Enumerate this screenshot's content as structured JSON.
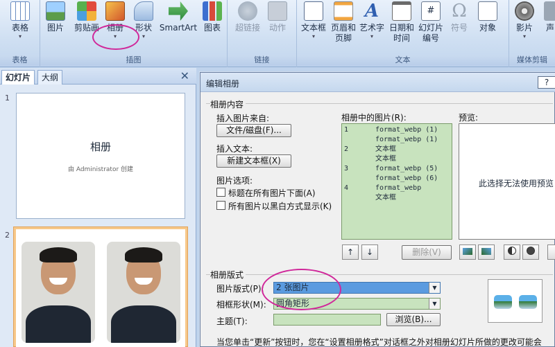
{
  "ribbon": {
    "groups": {
      "table": "表格",
      "illustrations": "插图",
      "links": "链接",
      "text": "文本",
      "media": "媒体剪辑"
    },
    "buttons": {
      "table": "表格",
      "picture": "图片",
      "clipart": "剪贴画",
      "album": "相册",
      "shapes": "形状",
      "smartart": "SmartArt",
      "chart": "图表",
      "hyperlink": "超链接",
      "action": "动作",
      "textbox": "文本框",
      "header_1": "页眉和",
      "header_2": "页脚",
      "wordart": "艺术字",
      "datetime_1": "日期和",
      "datetime_2": "时间",
      "slidenum_1": "幻灯片",
      "slidenum_2": "编号",
      "symbol": "符号",
      "object": "对象",
      "movie": "影片",
      "sound": "声"
    },
    "arrow": "▾",
    "colors": {
      "album_circle": "#d0289a"
    }
  },
  "panel": {
    "tab_slides": "幻灯片",
    "tab_outline": "大纲",
    "close": "✕",
    "slide1_num": "1",
    "slide1_title": "相册",
    "slide1_subtitle": "由 Administrator 创建",
    "slide2_num": "2"
  },
  "dialog": {
    "title": "编辑相册",
    "help": "?",
    "section_content": "相册内容",
    "insert_from": "插入图片来自:",
    "file_disk_btn": "文件/磁盘(F)...",
    "insert_text": "插入文本:",
    "new_textbox_btn": "新建文本框(X)",
    "pic_options": "图片选项:",
    "opt_captions": "标题在所有图片下面(A)",
    "opt_bw": "所有图片以黑白方式显示(K)",
    "list_label": "相册中的图片(R):",
    "list_items": [
      {
        "n": "1",
        "t": "format_webp (1)"
      },
      {
        "n": "",
        "t": "format_webp (1)"
      },
      {
        "n": "2",
        "t": "文本框"
      },
      {
        "n": "",
        "t": "文本框"
      },
      {
        "n": "3",
        "t": "format_webp (5)"
      },
      {
        "n": "",
        "t": "format_webp (6)"
      },
      {
        "n": "4",
        "t": "format_webp"
      },
      {
        "n": "",
        "t": "文本框"
      }
    ],
    "preview_label": "预览:",
    "preview_text": "此选择无法使用预览",
    "up_icon": "↑",
    "down_icon": "↓",
    "delete_btn": "删除(V)",
    "section_layout": "相册版式",
    "pic_layout_label": "图片版式(P):",
    "pic_layout_value": "2 张图片",
    "frame_label": "相框形状(M):",
    "frame_value": "圆角矩形",
    "theme_label": "主题(T):",
    "theme_value": "",
    "browse_btn": "浏览(B)...",
    "footer_text": "当您单击“更新”按钮时，您在“设置相册格式”对话框之外对相册幻灯片所做的更改可能会"
  }
}
